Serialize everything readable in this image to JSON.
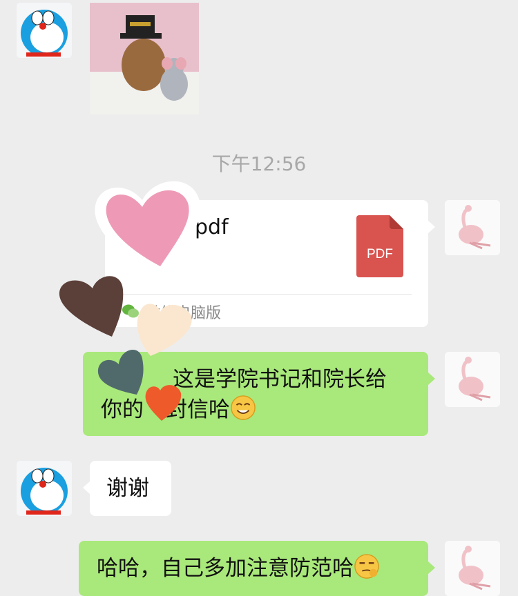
{
  "chat": {
    "timestamp": "下午12:56",
    "file_card": {
      "file_name": "pdf",
      "file_icon_label": "PDF",
      "source_label": "微信电脑版"
    },
    "messages": [
      {
        "id": "m1",
        "text_before": "这是学院书记和院长给",
        "text_line2_a": "你的",
        "text_line2_b": "封信哈"
      },
      {
        "id": "m2",
        "text": "谢谢"
      },
      {
        "id": "m3",
        "text": "哈哈，自己多加注意防范哈"
      }
    ]
  },
  "colors": {
    "background": "#ededed",
    "outgoing_bubble": "#a9e87a",
    "incoming_bubble": "#ffffff",
    "timestamp_text": "#a8a8a8",
    "pdf_icon": "#d9534f"
  },
  "icons": [
    "doraemon-avatar-icon",
    "flamingo-avatar-icon",
    "pdf-file-icon",
    "wechat-icon",
    "smiling-emoji-icon",
    "smirk-emoji-icon",
    "heart-sticker-icon"
  ]
}
